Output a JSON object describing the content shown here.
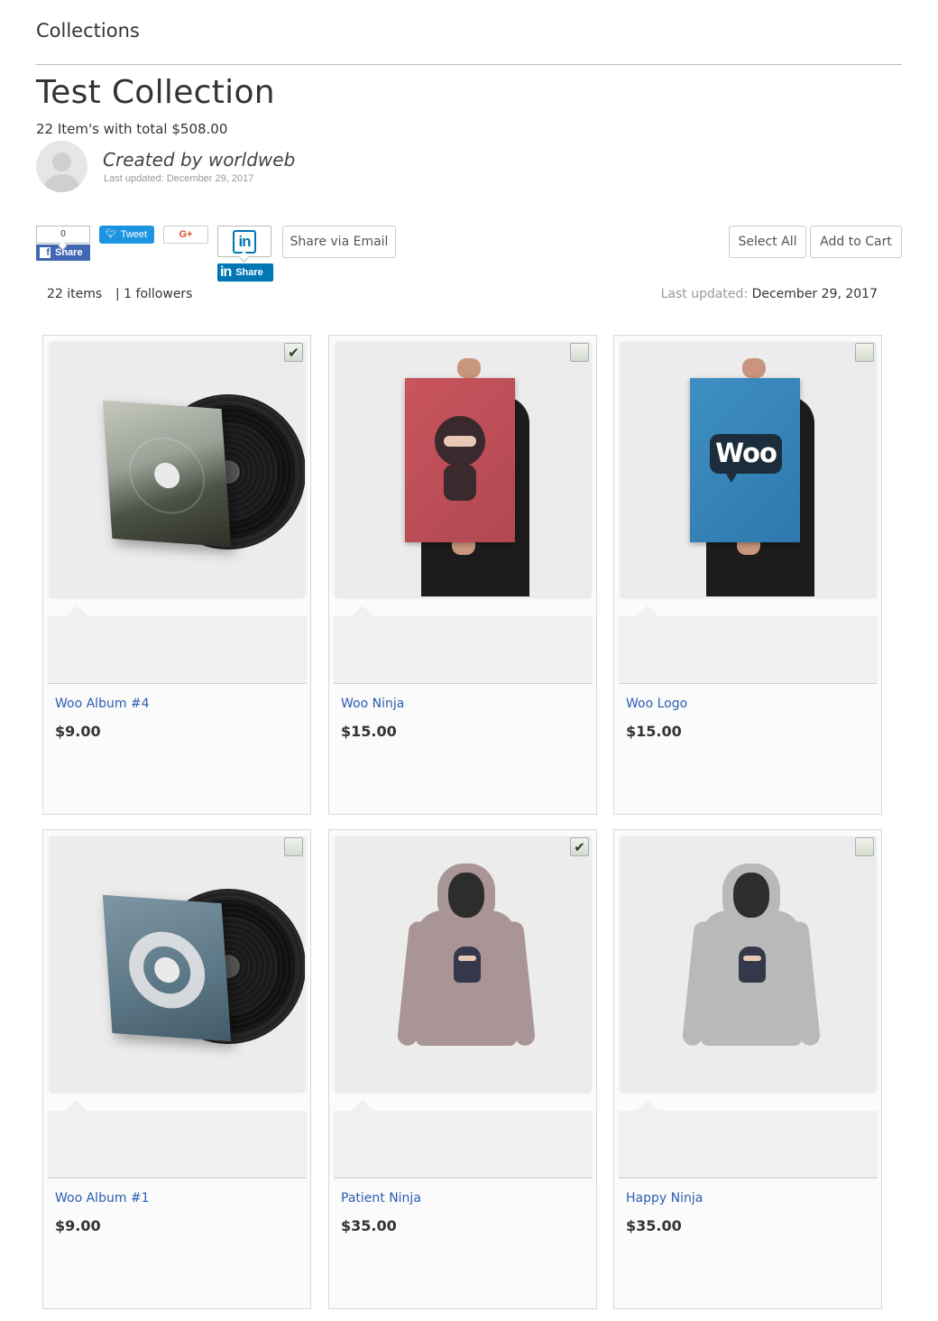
{
  "breadcrumb": "Collections",
  "collection": {
    "title": "Test Collection",
    "summary": "22 Item's with total $508.00",
    "creator": "Created by worldweb",
    "last_updated_small": "Last updated: December 29, 2017"
  },
  "share": {
    "facebook_count": "0",
    "facebook_label": "Share",
    "twitter_label": "Tweet",
    "googleplus_label": "G+",
    "linkedin_logo": "in",
    "linkedin_label": "Share",
    "email_label": "Share via Email"
  },
  "actions": {
    "select_all": "Select All",
    "add_to_cart": "Add to Cart"
  },
  "stats": {
    "items": "22 items",
    "followers": "|  1 followers",
    "updated_label": "Last updated:",
    "updated_value": "December 29, 2017"
  },
  "products": [
    {
      "name": "Woo Album #4",
      "price": "$9.00",
      "checked": true,
      "art": "vinyl-mountain"
    },
    {
      "name": "Woo Ninja",
      "price": "$15.00",
      "checked": false,
      "art": "poster-ninja"
    },
    {
      "name": "Woo Logo",
      "price": "$15.00",
      "checked": false,
      "art": "poster-woo"
    },
    {
      "name": "Woo Album #1",
      "price": "$9.00",
      "checked": false,
      "art": "vinyl-blue"
    },
    {
      "name": "Patient Ninja",
      "price": "$35.00",
      "checked": true,
      "art": "hoodie-mauve"
    },
    {
      "name": "Happy Ninja",
      "price": "$35.00",
      "checked": false,
      "art": "hoodie-grey"
    }
  ],
  "poster_logo_text": "Woo",
  "colors": {
    "link": "#2a5db0",
    "facebook": "#4267b2",
    "twitter": "#1b95e0",
    "linkedin": "#0077b5",
    "googleplus": "#dd4b39"
  }
}
